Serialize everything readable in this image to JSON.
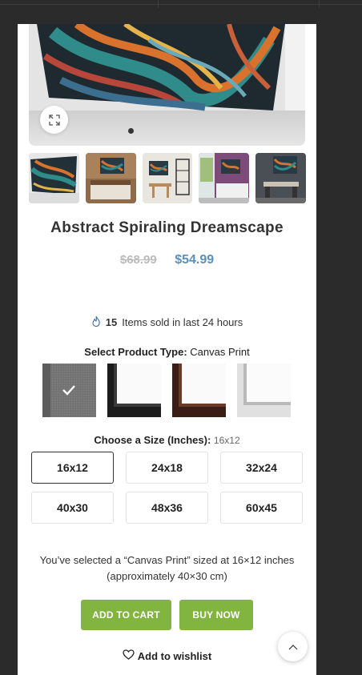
{
  "product": {
    "title": "Abstract Spiraling Dreamscape",
    "old_price": "$68.99",
    "new_price": "$54.99"
  },
  "sales": {
    "count": "15",
    "text": "Items sold in last 24 hours"
  },
  "product_type": {
    "label": "Select Product Type",
    "separator": ":",
    "selected": "Canvas Print",
    "options": [
      "Canvas Print",
      "Black Frame",
      "Brown Frame",
      "White Frame"
    ]
  },
  "size": {
    "label": "Choose a Size (Inches)",
    "separator": ":",
    "selected": "16x12",
    "options": [
      "16x12",
      "24x18",
      "32x24",
      "40x30",
      "48x36",
      "60x45"
    ]
  },
  "summary": {
    "line1": "You’ve selected a “Canvas Print” sized at 16×12 inches",
    "line2": "(approximately 40×30 cm)"
  },
  "buttons": {
    "add_to_cart": "Add to cart",
    "buy_now": "Buy now",
    "wishlist": "Add to wishlist"
  },
  "gallery": {
    "active_slide": 1,
    "thumbnail_count": 5
  },
  "colors": {
    "accent_green": "#82b440",
    "price_blue": "#5b8fb9",
    "background": "#2b2b2b"
  },
  "icons": {
    "zoom": "expand-icon",
    "sold": "flame-icon",
    "check": "checkmark-icon",
    "wishlist": "heart-icon",
    "scroll": "chevron-up-icon"
  }
}
